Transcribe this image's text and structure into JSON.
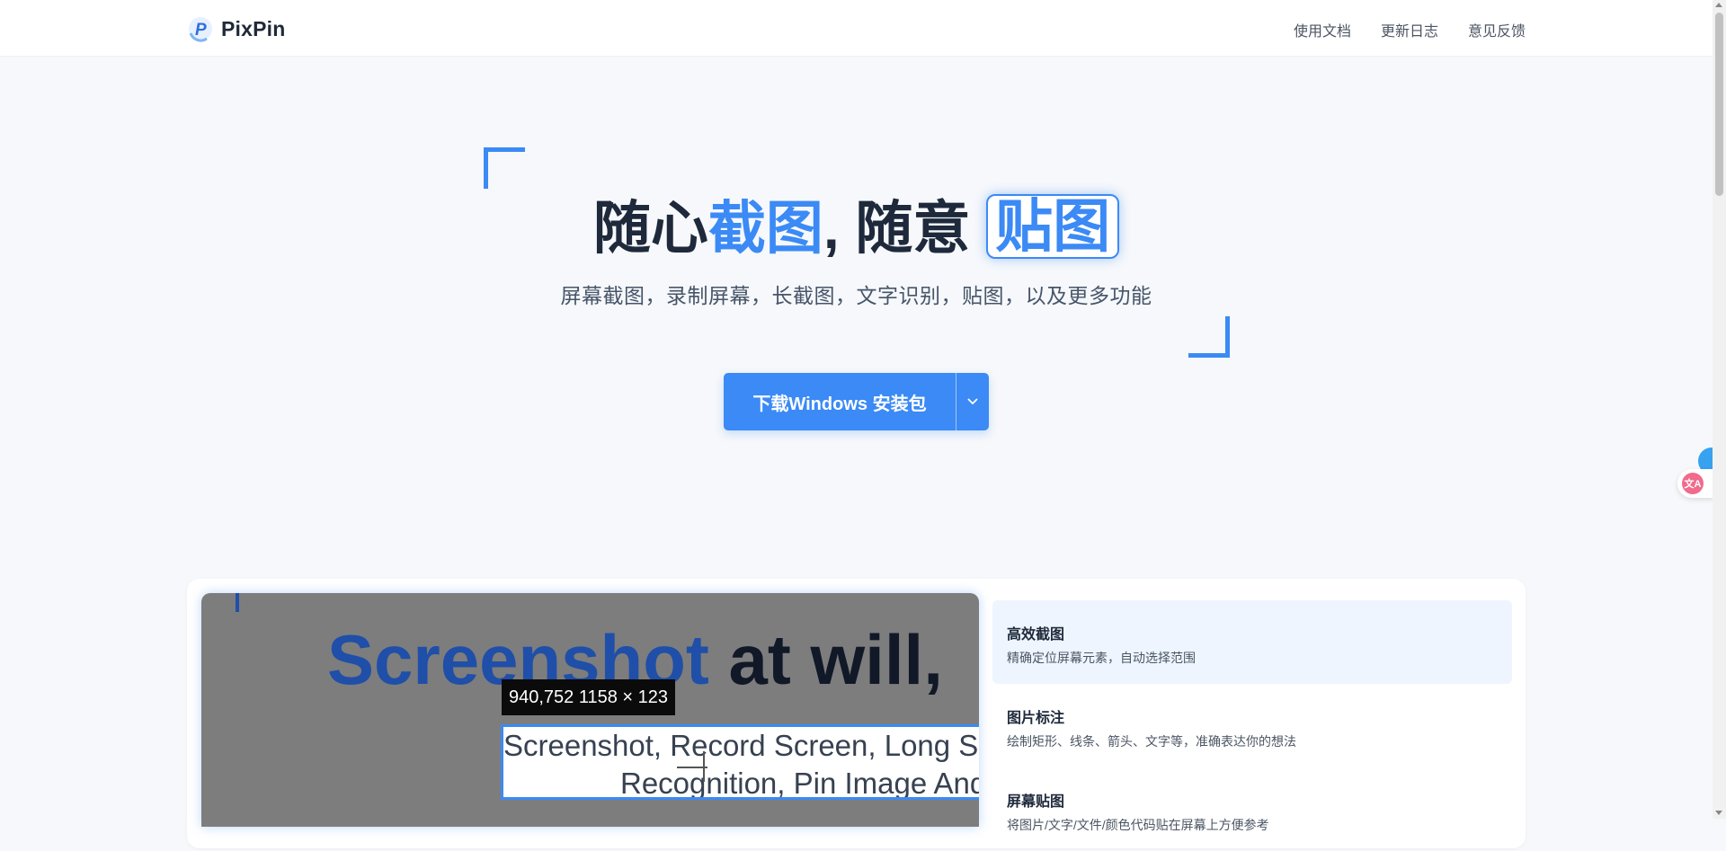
{
  "header": {
    "logo_text": "PixPin",
    "nav": [
      "使用文档",
      "更新日志",
      "意见反馈"
    ]
  },
  "hero": {
    "title_part1": "随心",
    "title_part2": "截图",
    "title_part3": ", 随意 ",
    "title_part4": "贴图",
    "subtitle": "屏幕截图，录制屏幕，长截图，文字识别，贴图，以及更多功能",
    "download_label": "下载Windows 安装包"
  },
  "demo": {
    "title_blue": "Screenshot",
    "title_rest": " at will,",
    "tooltip": "940,752  1158 × 123",
    "sel_line1": "Screenshot, Record Screen, Long S",
    "sel_line2": "Recognition, Pin Image And"
  },
  "features": [
    {
      "title": "高效截图",
      "desc": "精确定位屏幕元素，自动选择范围"
    },
    {
      "title": "图片标注",
      "desc": "绘制矩形、线条、箭头、文字等，准确表达你的想法"
    },
    {
      "title": "屏幕贴图",
      "desc": "将图片/文字/文件/颜色代码贴在屏幕上方便参考"
    }
  ],
  "widget": {
    "badge": "文A"
  },
  "colors": {
    "accent": "#3b8af5",
    "text_dark": "#1e293b",
    "demo_bg": "#7d7d7d"
  },
  "icons": [
    "pixpin-logo-icon",
    "chevron-down-icon",
    "translate-icon"
  ]
}
